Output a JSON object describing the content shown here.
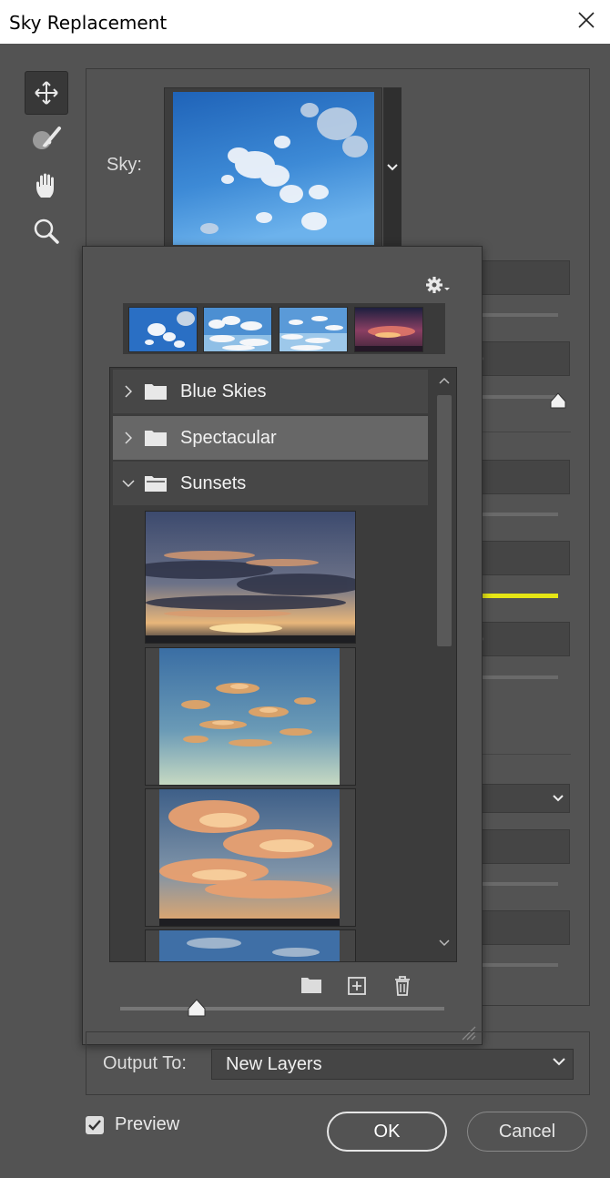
{
  "window": {
    "title": "Sky Replacement"
  },
  "tools": [
    {
      "name": "move-tool",
      "icon": "move-icon",
      "active": true
    },
    {
      "name": "sky-brush-tool",
      "icon": "sky-brush-icon",
      "active": false
    },
    {
      "name": "hand-tool",
      "icon": "hand-icon",
      "active": false
    },
    {
      "name": "zoom-tool",
      "icon": "zoom-icon",
      "active": false
    }
  ],
  "sky": {
    "label": "Sky:"
  },
  "presets": {
    "folders": [
      {
        "label": "Blue Skies",
        "expanded": false,
        "selected": false
      },
      {
        "label": "Spectacular",
        "expanded": false,
        "selected": true
      },
      {
        "label": "Sunsets",
        "expanded": true,
        "selected": false
      }
    ],
    "recent_count": 4,
    "footer_icons": [
      "folder-icon",
      "new-sky-icon",
      "trash-icon"
    ],
    "thumbnail_size_fraction": 0.23
  },
  "output": {
    "label": "Output To:",
    "value": "New Layers"
  },
  "preview": {
    "label": "Preview",
    "checked": true
  },
  "buttons": {
    "ok": "OK",
    "cancel": "Cancel"
  },
  "colors": {
    "panel": "#535353",
    "highlight": "#e6e615"
  }
}
